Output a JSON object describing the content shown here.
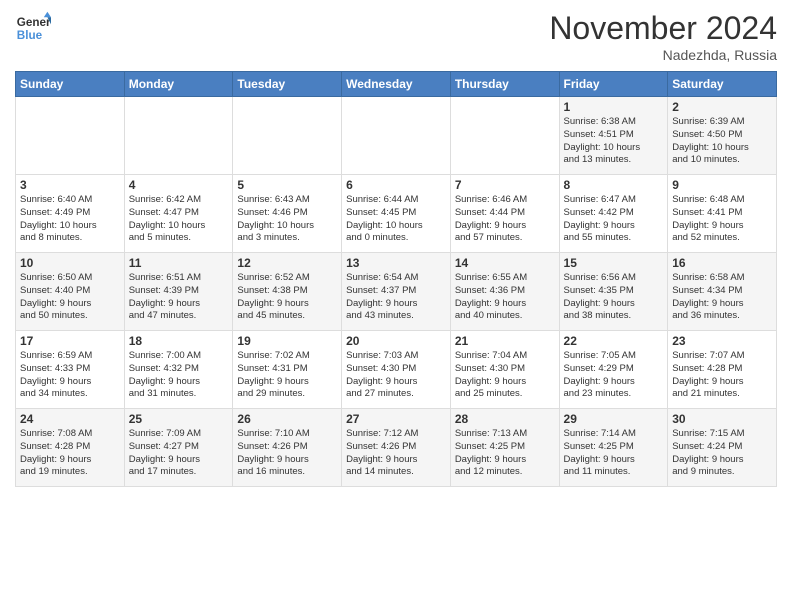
{
  "logo": {
    "line1": "General",
    "line2": "Blue"
  },
  "title": "November 2024",
  "location": "Nadezhda, Russia",
  "days_header": [
    "Sunday",
    "Monday",
    "Tuesday",
    "Wednesday",
    "Thursday",
    "Friday",
    "Saturday"
  ],
  "weeks": [
    [
      {
        "day": "",
        "info": ""
      },
      {
        "day": "",
        "info": ""
      },
      {
        "day": "",
        "info": ""
      },
      {
        "day": "",
        "info": ""
      },
      {
        "day": "",
        "info": ""
      },
      {
        "day": "1",
        "info": "Sunrise: 6:38 AM\nSunset: 4:51 PM\nDaylight: 10 hours\nand 13 minutes."
      },
      {
        "day": "2",
        "info": "Sunrise: 6:39 AM\nSunset: 4:50 PM\nDaylight: 10 hours\nand 10 minutes."
      }
    ],
    [
      {
        "day": "3",
        "info": "Sunrise: 6:40 AM\nSunset: 4:49 PM\nDaylight: 10 hours\nand 8 minutes."
      },
      {
        "day": "4",
        "info": "Sunrise: 6:42 AM\nSunset: 4:47 PM\nDaylight: 10 hours\nand 5 minutes."
      },
      {
        "day": "5",
        "info": "Sunrise: 6:43 AM\nSunset: 4:46 PM\nDaylight: 10 hours\nand 3 minutes."
      },
      {
        "day": "6",
        "info": "Sunrise: 6:44 AM\nSunset: 4:45 PM\nDaylight: 10 hours\nand 0 minutes."
      },
      {
        "day": "7",
        "info": "Sunrise: 6:46 AM\nSunset: 4:44 PM\nDaylight: 9 hours\nand 57 minutes."
      },
      {
        "day": "8",
        "info": "Sunrise: 6:47 AM\nSunset: 4:42 PM\nDaylight: 9 hours\nand 55 minutes."
      },
      {
        "day": "9",
        "info": "Sunrise: 6:48 AM\nSunset: 4:41 PM\nDaylight: 9 hours\nand 52 minutes."
      }
    ],
    [
      {
        "day": "10",
        "info": "Sunrise: 6:50 AM\nSunset: 4:40 PM\nDaylight: 9 hours\nand 50 minutes."
      },
      {
        "day": "11",
        "info": "Sunrise: 6:51 AM\nSunset: 4:39 PM\nDaylight: 9 hours\nand 47 minutes."
      },
      {
        "day": "12",
        "info": "Sunrise: 6:52 AM\nSunset: 4:38 PM\nDaylight: 9 hours\nand 45 minutes."
      },
      {
        "day": "13",
        "info": "Sunrise: 6:54 AM\nSunset: 4:37 PM\nDaylight: 9 hours\nand 43 minutes."
      },
      {
        "day": "14",
        "info": "Sunrise: 6:55 AM\nSunset: 4:36 PM\nDaylight: 9 hours\nand 40 minutes."
      },
      {
        "day": "15",
        "info": "Sunrise: 6:56 AM\nSunset: 4:35 PM\nDaylight: 9 hours\nand 38 minutes."
      },
      {
        "day": "16",
        "info": "Sunrise: 6:58 AM\nSunset: 4:34 PM\nDaylight: 9 hours\nand 36 minutes."
      }
    ],
    [
      {
        "day": "17",
        "info": "Sunrise: 6:59 AM\nSunset: 4:33 PM\nDaylight: 9 hours\nand 34 minutes."
      },
      {
        "day": "18",
        "info": "Sunrise: 7:00 AM\nSunset: 4:32 PM\nDaylight: 9 hours\nand 31 minutes."
      },
      {
        "day": "19",
        "info": "Sunrise: 7:02 AM\nSunset: 4:31 PM\nDaylight: 9 hours\nand 29 minutes."
      },
      {
        "day": "20",
        "info": "Sunrise: 7:03 AM\nSunset: 4:30 PM\nDaylight: 9 hours\nand 27 minutes."
      },
      {
        "day": "21",
        "info": "Sunrise: 7:04 AM\nSunset: 4:30 PM\nDaylight: 9 hours\nand 25 minutes."
      },
      {
        "day": "22",
        "info": "Sunrise: 7:05 AM\nSunset: 4:29 PM\nDaylight: 9 hours\nand 23 minutes."
      },
      {
        "day": "23",
        "info": "Sunrise: 7:07 AM\nSunset: 4:28 PM\nDaylight: 9 hours\nand 21 minutes."
      }
    ],
    [
      {
        "day": "24",
        "info": "Sunrise: 7:08 AM\nSunset: 4:28 PM\nDaylight: 9 hours\nand 19 minutes."
      },
      {
        "day": "25",
        "info": "Sunrise: 7:09 AM\nSunset: 4:27 PM\nDaylight: 9 hours\nand 17 minutes."
      },
      {
        "day": "26",
        "info": "Sunrise: 7:10 AM\nSunset: 4:26 PM\nDaylight: 9 hours\nand 16 minutes."
      },
      {
        "day": "27",
        "info": "Sunrise: 7:12 AM\nSunset: 4:26 PM\nDaylight: 9 hours\nand 14 minutes."
      },
      {
        "day": "28",
        "info": "Sunrise: 7:13 AM\nSunset: 4:25 PM\nDaylight: 9 hours\nand 12 minutes."
      },
      {
        "day": "29",
        "info": "Sunrise: 7:14 AM\nSunset: 4:25 PM\nDaylight: 9 hours\nand 11 minutes."
      },
      {
        "day": "30",
        "info": "Sunrise: 7:15 AM\nSunset: 4:24 PM\nDaylight: 9 hours\nand 9 minutes."
      }
    ]
  ]
}
